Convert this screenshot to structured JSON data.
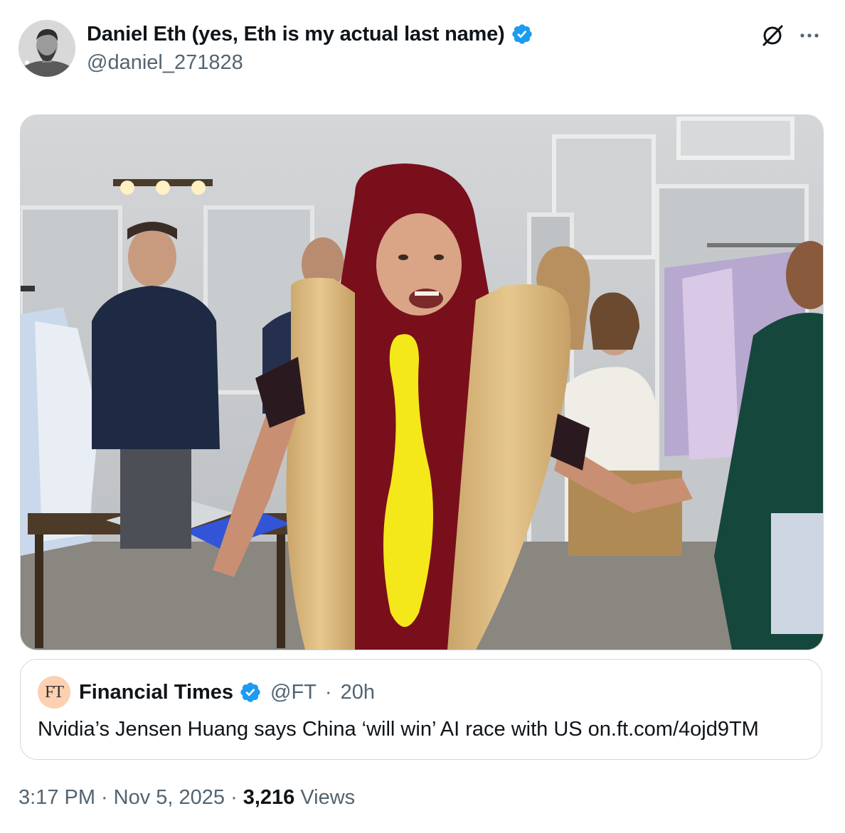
{
  "author": {
    "display_name": "Daniel Eth (yes, Eth is my actual last name)",
    "handle": "@daniel_271828",
    "verified": true
  },
  "icons": {
    "verified": "verified-badge-icon",
    "grok": "grok-icon",
    "more": "more-options-icon"
  },
  "colors": {
    "verified_blue": "#1d9bf0",
    "secondary_text": "#536471",
    "primary_text": "#0f1419",
    "border": "#cfd9de",
    "ft_logo_bg": "#fcd0b1"
  },
  "quoted_tweet": {
    "logo_text": "FT",
    "name": "Financial Times",
    "handle": "@FT",
    "separator": "·",
    "time": "20h",
    "text": "Nvidia’s Jensen Huang says China ‘will win’ AI race with US on.ft.com/4ojd9TM"
  },
  "footer": {
    "time": "3:17 PM",
    "sep1": "·",
    "date": "Nov 5, 2025",
    "sep2": "·",
    "views_count": "3,216",
    "views_label": "Views"
  }
}
